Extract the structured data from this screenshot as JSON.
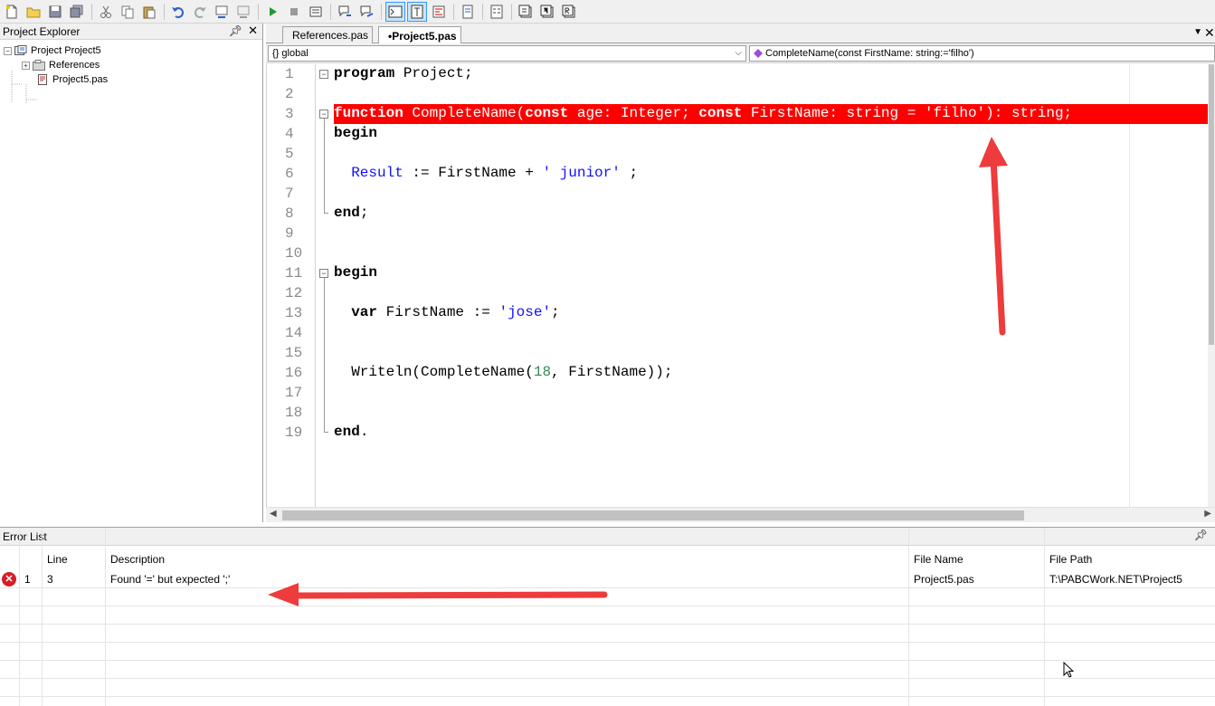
{
  "toolbar": {
    "buttons": [
      "new-file",
      "open-file",
      "save",
      "save-all",
      "cut",
      "copy",
      "paste",
      "undo",
      "redo",
      "step-back",
      "step-forward",
      "run",
      "stop",
      "breakpoints",
      "comment",
      "uncomment",
      "show-output",
      "text-mode",
      "format",
      "bookmark",
      "structure",
      "run-script",
      "run-debug",
      "run-release"
    ]
  },
  "explorer": {
    "title": "Project Explorer",
    "root": "Project Project5",
    "items": [
      "References",
      "Project5.pas"
    ]
  },
  "editor": {
    "tabs": [
      {
        "label": "References.pas",
        "active": false
      },
      {
        "label": "•Project5.pas",
        "active": true
      }
    ],
    "scope_combo": "{} global",
    "member_combo": "CompleteName(const FirstName: string:='filho')",
    "error_line": 3,
    "lines": [
      {
        "n": "1",
        "code": [
          {
            "t": "program",
            "k": "kw"
          },
          {
            "t": " Project;",
            "k": ""
          }
        ]
      },
      {
        "n": "2",
        "code": []
      },
      {
        "n": "3",
        "code": [
          {
            "t": "function",
            "k": "kw"
          },
          {
            "t": " CompleteName(",
            "k": ""
          },
          {
            "t": "const",
            "k": "kw"
          },
          {
            "t": " age: Integer; ",
            "k": ""
          },
          {
            "t": "const",
            "k": "kw"
          },
          {
            "t": " FirstName: string = 'filho'): string;",
            "k": ""
          }
        ]
      },
      {
        "n": "4",
        "code": [
          {
            "t": "begin",
            "k": "kw"
          }
        ]
      },
      {
        "n": "5",
        "code": []
      },
      {
        "n": "6",
        "code": [
          {
            "t": "  Result := FirstName + ",
            "k": "res"
          },
          {
            "t": "' junior'",
            "k": "str"
          },
          {
            "t": " ;",
            "k": ""
          }
        ]
      },
      {
        "n": "7",
        "code": []
      },
      {
        "n": "8",
        "code": [
          {
            "t": "end",
            "k": "kw"
          },
          {
            "t": ";",
            "k": ""
          }
        ]
      },
      {
        "n": "9",
        "code": []
      },
      {
        "n": "10",
        "code": []
      },
      {
        "n": "11",
        "code": [
          {
            "t": "begin",
            "k": "kw"
          }
        ]
      },
      {
        "n": "12",
        "code": []
      },
      {
        "n": "13",
        "code": [
          {
            "t": "  ",
            "k": ""
          },
          {
            "t": "var",
            "k": "kw"
          },
          {
            "t": " FirstName := ",
            "k": ""
          },
          {
            "t": "'jose'",
            "k": "str"
          },
          {
            "t": ";",
            "k": ""
          }
        ]
      },
      {
        "n": "14",
        "code": []
      },
      {
        "n": "15",
        "code": []
      },
      {
        "n": "16",
        "code": [
          {
            "t": "  Writeln(CompleteName(",
            "k": ""
          },
          {
            "t": "18",
            "k": "num"
          },
          {
            "t": ", FirstName));",
            "k": ""
          }
        ]
      },
      {
        "n": "17",
        "code": []
      },
      {
        "n": "18",
        "code": []
      },
      {
        "n": "19",
        "code": [
          {
            "t": "end",
            "k": "kw"
          },
          {
            "t": ".",
            "k": ""
          }
        ]
      }
    ]
  },
  "error_list": {
    "title": "Error List",
    "headers": {
      "line": "Line",
      "description": "Description",
      "file_name": "File Name",
      "file_path": "File Path"
    },
    "rows": [
      {
        "index": "1",
        "line": "3",
        "description": "Found '=' but expected ';'",
        "file_name": "Project5.pas",
        "file_path": "T:\\PABCWork.NET\\Project5"
      }
    ]
  },
  "colors": {
    "error_highlight": "#ff0000",
    "annotation_arrow": "#ee3b3b",
    "string_literal": "#1010ff",
    "number_literal": "#2e8b57"
  }
}
